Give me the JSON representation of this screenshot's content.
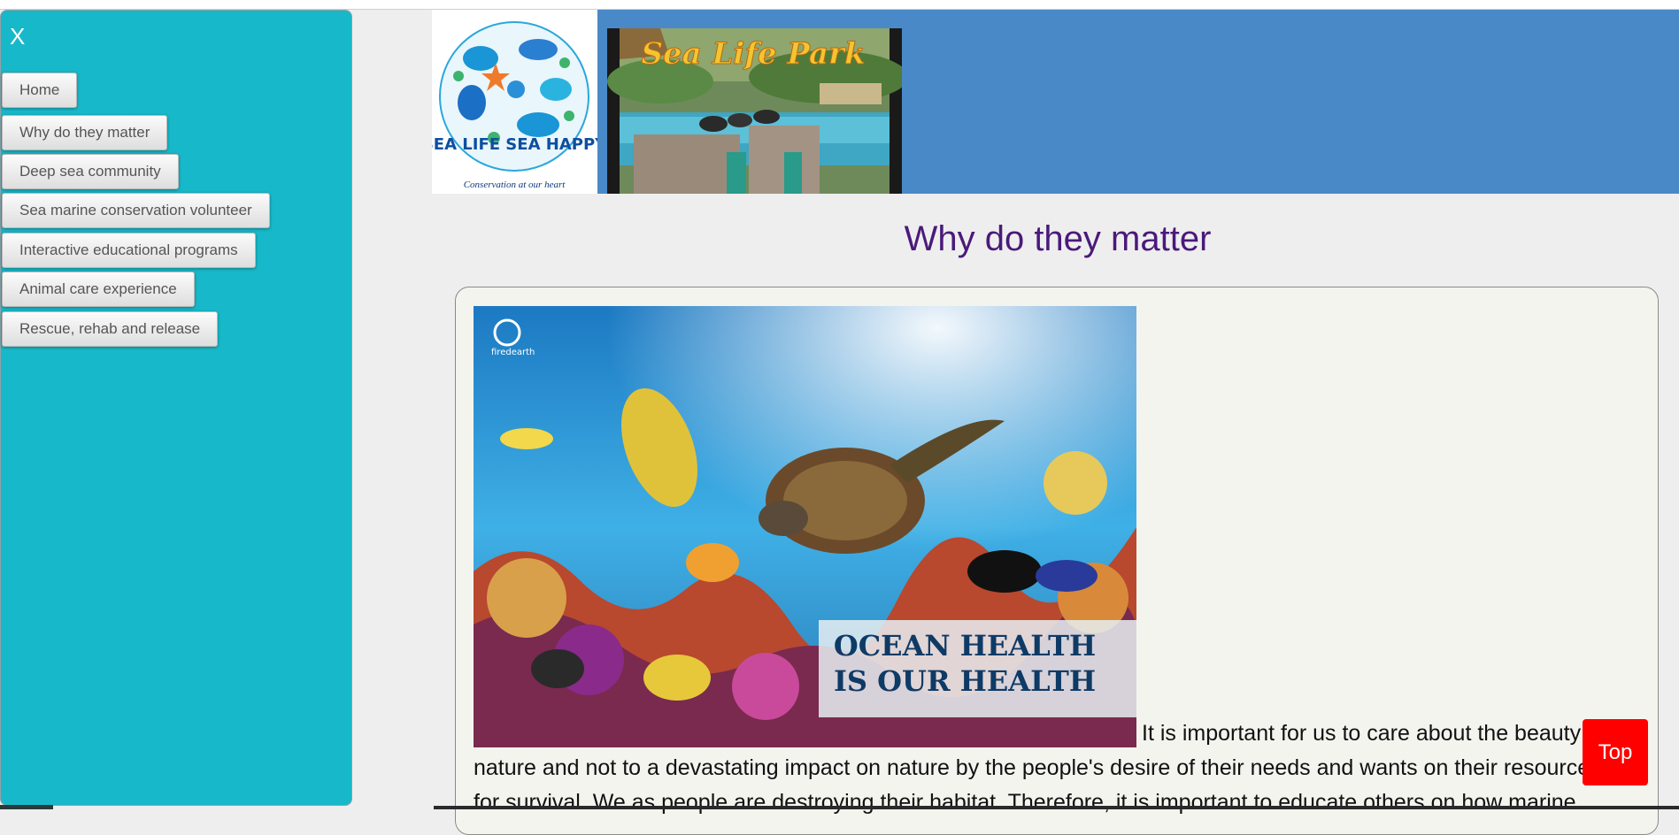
{
  "sidebar": {
    "close_label": "X",
    "items": [
      {
        "label": "Home"
      },
      {
        "label": "Why do they matter"
      },
      {
        "label": "Deep sea community"
      },
      {
        "label": "Sea marine conservation volunteer"
      },
      {
        "label": "Interactive educational programs"
      },
      {
        "label": "Animal care experience"
      },
      {
        "label": "Rescue, rehab and release"
      }
    ]
  },
  "header": {
    "logo": {
      "main_text": "SEA LIFE SEA HAPPY",
      "tagline": "Conservation at our heart"
    },
    "park_sign": "Sea Life Park"
  },
  "main": {
    "title": "Why do they matter",
    "hero": {
      "brand": "firedearth",
      "caption_line1": "OCEAN HEALTH",
      "caption_line2": "IS OUR HEALTH"
    },
    "paragraph": "It is important for us to care about the beauty of nature and not to a devastating impact on nature by the people's desire of their needs and wants on their resources for survival. We as people are destroying their habitat. Therefore, it is important to educate others on how marine"
  },
  "top_button": "Top",
  "colors": {
    "sidebar_bg": "#17b8c9",
    "header_bg": "#4a89c8",
    "title": "#4a1a7a",
    "top_button": "#ff0000"
  }
}
